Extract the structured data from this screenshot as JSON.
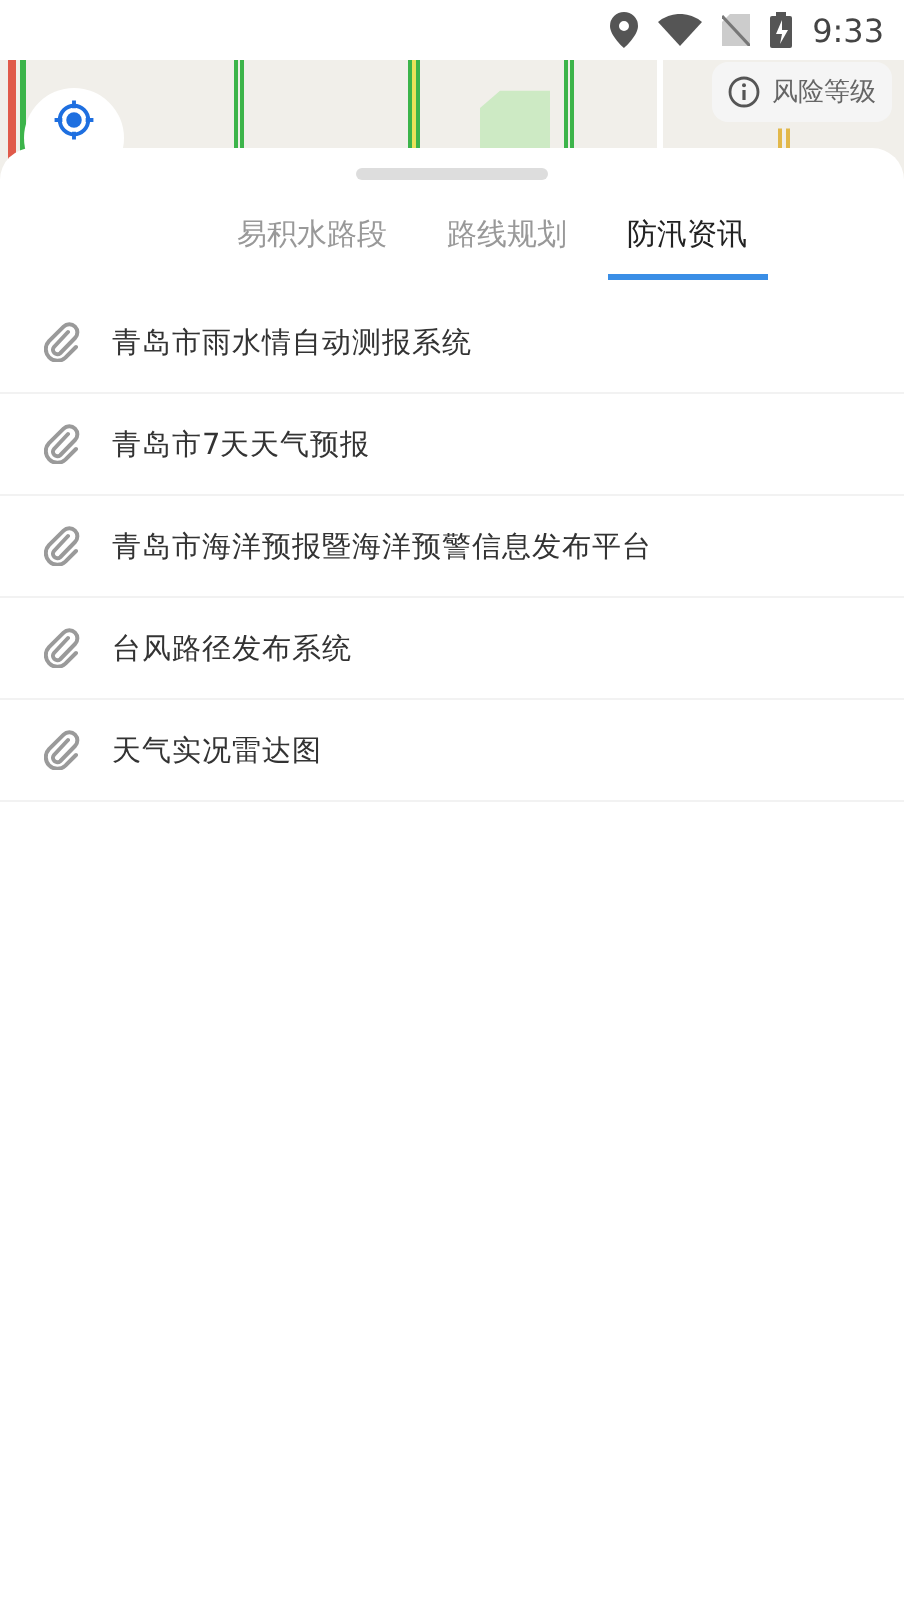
{
  "status_bar": {
    "time": "9:33"
  },
  "map": {
    "kind": "picture",
    "risk_button": {
      "label": "风险等级"
    }
  },
  "tabs": [
    {
      "label": "易积水路段",
      "selected": false
    },
    {
      "label": "路线规划",
      "selected": false
    },
    {
      "label": "防汛资讯",
      "selected": true
    }
  ],
  "links": [
    {
      "title": "青岛市雨水情自动测报系统"
    },
    {
      "title": "青岛市7天天气预报"
    },
    {
      "title": "青岛市海洋预报暨海洋预警信息发布平台"
    },
    {
      "title": "台风路径发布系统"
    },
    {
      "title": "天气实况雷达图"
    }
  ]
}
